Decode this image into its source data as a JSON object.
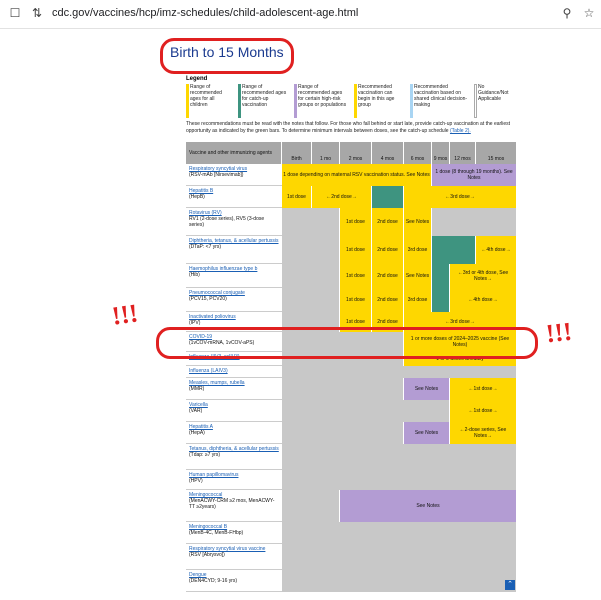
{
  "browser": {
    "url": "cdc.gov/vaccines/hcp/imz-schedules/child-adolescent-age.html"
  },
  "page_title": "Birth to 15 Months",
  "legend": {
    "title": "Legend",
    "items": [
      {
        "label": "Range of recommended ages for all children",
        "color": "#fed700"
      },
      {
        "label": "Range of recommended ages for catch-up vaccination",
        "color": "#3e9480"
      },
      {
        "label": "Range of recommended ages for certain high-risk groups or populations",
        "color": "#b39cd3"
      },
      {
        "label": "Recommended vaccination can begin in this age group",
        "color": "#fed700"
      },
      {
        "label": "Recommended vaccination based on shared clinical decision-making",
        "color": "#a9d5f3"
      },
      {
        "label": "No Guidance/Not Applicable",
        "color": "#ffffff"
      }
    ]
  },
  "note": {
    "text": "These recommendations must be read with the notes that follow. For those who fall behind or start late, provide catch-up vaccination at the earliest opportunity as indicated by the green bars. To determine minimum intervals between doses, see the catch-up schedule",
    "link": "(Table 2)."
  },
  "table": {
    "headers": [
      "Vaccine and other immunizing agents",
      "Birth",
      "1 mo",
      "2 mos",
      "4 mos",
      "6 mos",
      "9 mos",
      "12 mos",
      "15 mos"
    ],
    "rows": [
      {
        "name": "Respiratory syncytial virus",
        "sub": "(RSV-mAb [Nirsevimab])",
        "cell1": "1 dose depending on maternal RSV vaccination status. See Notes",
        "cell2": "1 dose (8 through 19 months). See Notes"
      },
      {
        "name": "Hepatitis B",
        "sub": "(HepB)",
        "d1": "1st dose",
        "d2": "←2nd dose→",
        "d3": "←3rd dose→"
      },
      {
        "name": "Rotavirus (RV)",
        "sub": "RV1 (2-dose series), RV5 (3-dose series)",
        "d1": "1st dose",
        "d2": "2nd dose",
        "d3": "See Notes"
      },
      {
        "name": "Diphtheria, tetanus, & acellular pertussis",
        "sub": "(DTaP: <7 yrs)",
        "d1": "1st dose",
        "d2": "2nd dose",
        "d3": "3rd dose",
        "d4": "←4th dose→"
      },
      {
        "name": "Haemophilus influenzae type b",
        "sub": "(Hib)",
        "d1": "1st dose",
        "d2": "2nd dose",
        "d3": "See Notes",
        "d4": "←3rd or 4th dose, See Notes→"
      },
      {
        "name": "Pneumococcal conjugate",
        "sub": "(PCV15, PCV20)",
        "d1": "1st dose",
        "d2": "2nd dose",
        "d3": "3rd dose",
        "d4": "←4th dose→"
      },
      {
        "name": "Inactivated poliovirus",
        "sub": "(IPV)",
        "d1": "1st dose",
        "d2": "2nd dose",
        "d3": "←3rd dose→"
      },
      {
        "name": "COVID-19",
        "sub": "(1vCOV-mRNA, 1vCOV-aPS)",
        "cell1": "1 or more doses of 2024–2025 vaccine (See Notes)"
      },
      {
        "name": "Influenza (IIV3, ccIIV3)",
        "sub": "",
        "cell1": "1 or 2 doses annually"
      },
      {
        "name": "Influenza (LAIV3)",
        "sub": ""
      },
      {
        "name": "Measles, mumps, rubella",
        "sub": "(MMR)",
        "cell1": "See Notes",
        "cell2": "←1st dose→"
      },
      {
        "name": "Varicella",
        "sub": "(VAR)",
        "cell1": "←1st dose→"
      },
      {
        "name": "Hepatitis A",
        "sub": "(HepA)",
        "cell1": "See Notes",
        "cell2": "←2-dose series, See Notes→"
      },
      {
        "name": "Tetanus, diphtheria, & acellular pertussis",
        "sub": "(Tdap: ≥7 yrs)"
      },
      {
        "name": "Human papillomavirus",
        "sub": "(HPV)"
      },
      {
        "name": "Meningococcal",
        "sub": "(MenACWY-CRM ≥2 mos, MenACWY-TT ≥2years)",
        "cell1": "See Notes"
      },
      {
        "name": "Meningococcal B",
        "sub": "(MenB-4C, MenB-FHbp)"
      },
      {
        "name": "Respiratory syncytial virus vaccine",
        "sub": "(RSV [Abrysvo])"
      },
      {
        "name": "Dengue",
        "sub": "(DEN4CYD; 9-16 yrs)"
      }
    ]
  },
  "annotations": {
    "left": "!!!",
    "right": "!!!"
  },
  "colors": {
    "yellow": "#fed700",
    "green": "#3e9480",
    "purple": "#b39cd3",
    "gray": "#c8c8c8",
    "red": "#e02020"
  },
  "icons": [
    "bookmark-icon",
    "site-settings-icon",
    "zoom-icon",
    "star-icon"
  ]
}
